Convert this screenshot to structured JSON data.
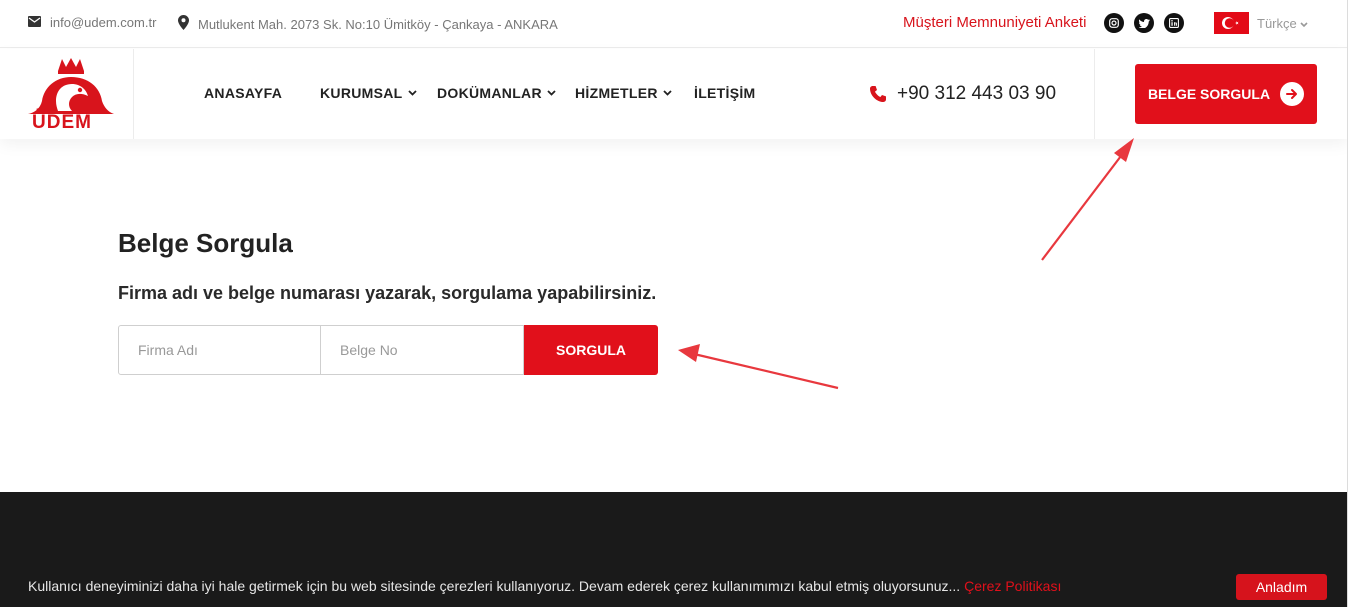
{
  "topbar": {
    "email": "info@udem.com.tr",
    "address": "Mutlukent Mah. 2073 Sk. No:10 Ümitköy - Çankaya - ANKARA",
    "survey_link": "Müşteri Memnuniyeti Anketi",
    "social_icons": [
      "instagram-icon",
      "twitter-icon",
      "linkedin-icon"
    ],
    "language": "Türkçe"
  },
  "header": {
    "logo_text": "UDEM",
    "nav": [
      {
        "label": "ANASAYFA",
        "has_dropdown": false
      },
      {
        "label": "KURUMSAL",
        "has_dropdown": true
      },
      {
        "label": "DOKÜMANLAR",
        "has_dropdown": true
      },
      {
        "label": "HİZMETLER",
        "has_dropdown": true
      },
      {
        "label": "İLETİŞİM",
        "has_dropdown": false
      }
    ],
    "phone": "+90 312 443 03 90",
    "cta_label": "BELGE SORGULA"
  },
  "main": {
    "title": "Belge Sorgula",
    "subtitle": "Firma adı ve belge numarası yazarak, sorgulama yapabilirsiniz.",
    "company_placeholder": "Firma Adı",
    "company_value": "",
    "doc_placeholder": "Belge No",
    "doc_value": "",
    "submit_label": "SORGULA"
  },
  "cookie": {
    "text": "Kullanıcı deneyiminizi daha iyi hale getirmek için bu web sitesinde çerezleri kullanıyoruz. Devam ederek çerez kullanımımızı kabul etmiş oluyorsunuz...",
    "policy_link": "Çerez Politikası",
    "accept_label": "Anladım"
  },
  "colors": {
    "brand_red": "#e1101b",
    "footer_bg": "#1a1a1a",
    "text_dark": "#222222"
  }
}
